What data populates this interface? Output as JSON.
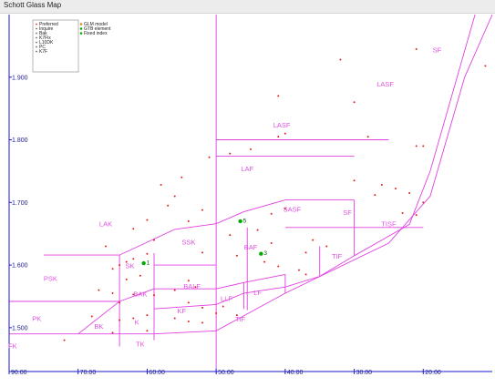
{
  "window": {
    "title": "Schott Glass Map"
  },
  "colors": {
    "axis": "#1a1acc",
    "boundary": "#e040e0",
    "region_label": "#e050e0",
    "glass_point": "#e02020",
    "model_point": "#00aa00",
    "fixed_point": "#00aa00"
  },
  "legend": {
    "left": [
      "Preferred",
      "Inquire",
      "Bak",
      "K7Fix",
      "L10DK",
      "PC",
      "K7F"
    ],
    "right": [
      {
        "label": "GLM model",
        "icon": "diamond-icon",
        "color": "#e08020"
      },
      {
        "label": "GTB element",
        "icon": "circle-icon",
        "color": "#00aa00"
      },
      {
        "label": "Fixed index",
        "icon": "star-icon",
        "color": "#00aa00"
      }
    ]
  },
  "chart_data": {
    "type": "scatter",
    "title": "",
    "xlabel": "",
    "ylabel": "",
    "xlim": [
      90,
      20
    ],
    "ylim": [
      1.43,
      2.0
    ],
    "x_ticks": [
      {
        "v": 90,
        "label": "90.00"
      },
      {
        "v": 80,
        "label": "70.00"
      },
      {
        "v": 70,
        "label": "60.00"
      },
      {
        "v": 60,
        "label": "50.00"
      },
      {
        "v": 50,
        "label": "40.00"
      },
      {
        "v": 40,
        "label": "30.00"
      },
      {
        "v": 30,
        "label": "20.00"
      }
    ],
    "y_ticks": [
      {
        "v": 1.5,
        "label": "1.500"
      },
      {
        "v": 1.6,
        "label": "1.600"
      },
      {
        "v": 1.7,
        "label": "1.700"
      },
      {
        "v": 1.8,
        "label": "1.800"
      },
      {
        "v": 1.9,
        "label": "1.900"
      }
    ],
    "regions": [
      {
        "name": "SF",
        "x": 28,
        "y": 1.94
      },
      {
        "name": "LASF",
        "x": 35.5,
        "y": 1.885
      },
      {
        "name": "LASF",
        "x": 50.5,
        "y": 1.82
      },
      {
        "name": "LAF",
        "x": 55.5,
        "y": 1.75
      },
      {
        "name": "SASF",
        "x": 49,
        "y": 1.685
      },
      {
        "name": "SF",
        "x": 41,
        "y": 1.68
      },
      {
        "name": "TISF",
        "x": 35,
        "y": 1.662
      },
      {
        "name": "LAK",
        "x": 76,
        "y": 1.662
      },
      {
        "name": "SSK",
        "x": 64,
        "y": 1.633
      },
      {
        "name": "BAF",
        "x": 55,
        "y": 1.625
      },
      {
        "name": "TIF",
        "x": 42.5,
        "y": 1.61
      },
      {
        "name": "SK",
        "x": 72.5,
        "y": 1.595
      },
      {
        "name": "PSK",
        "x": 84,
        "y": 1.575
      },
      {
        "name": "BALF",
        "x": 63.5,
        "y": 1.562
      },
      {
        "name": "BAK",
        "x": 71,
        "y": 1.55
      },
      {
        "name": "LF",
        "x": 54,
        "y": 1.552
      },
      {
        "name": "LLF",
        "x": 58.5,
        "y": 1.543
      },
      {
        "name": "KF",
        "x": 65,
        "y": 1.523
      },
      {
        "name": "PK",
        "x": 86,
        "y": 1.511
      },
      {
        "name": "TIF",
        "x": 56.5,
        "y": 1.51
      },
      {
        "name": "K",
        "x": 71.5,
        "y": 1.505
      },
      {
        "name": "BK",
        "x": 77,
        "y": 1.498
      },
      {
        "name": "FK",
        "x": 89.5,
        "y": 1.467
      },
      {
        "name": "TK",
        "x": 71,
        "y": 1.47
      }
    ],
    "boundaries": [
      [
        [
          60,
          2.0
        ],
        [
          60,
          1.43
        ]
      ],
      [
        [
          60,
          1.8
        ],
        [
          35,
          1.8
        ]
      ],
      [
        [
          60,
          1.774
        ],
        [
          40,
          1.774
        ]
      ],
      [
        [
          50,
          1.704
        ],
        [
          40,
          1.704
        ]
      ],
      [
        [
          85,
          1.616
        ],
        [
          74,
          1.616
        ],
        [
          66,
          1.657
        ],
        [
          60,
          1.666
        ],
        [
          56,
          1.685
        ],
        [
          50,
          1.704
        ]
      ],
      [
        [
          74,
          1.616
        ],
        [
          74,
          1.47
        ]
      ],
      [
        [
          69,
          1.619
        ],
        [
          69,
          1.48
        ]
      ],
      [
        [
          60,
          1.6
        ],
        [
          69,
          1.6
        ]
      ],
      [
        [
          55.5,
          1.66
        ],
        [
          55.5,
          1.528
        ]
      ],
      [
        [
          90,
          1.542
        ],
        [
          74,
          1.542
        ]
      ],
      [
        [
          90,
          1.49
        ],
        [
          80,
          1.49
        ],
        [
          74,
          1.542
        ],
        [
          69,
          1.562
        ],
        [
          60,
          1.562
        ],
        [
          56,
          1.572
        ],
        [
          50,
          1.585
        ]
      ],
      [
        [
          74,
          1.49
        ],
        [
          69,
          1.49
        ]
      ],
      [
        [
          80,
          1.49
        ],
        [
          74,
          1.49
        ]
      ],
      [
        [
          69,
          1.49
        ],
        [
          60,
          1.495
        ],
        [
          50,
          1.555
        ],
        [
          35,
          1.635
        ],
        [
          29,
          1.71
        ],
        [
          24,
          1.9
        ],
        [
          20,
          2.0
        ]
      ],
      [
        [
          69,
          1.53
        ],
        [
          60,
          1.537
        ],
        [
          56,
          1.555
        ],
        [
          50,
          1.565
        ],
        [
          45,
          1.582
        ],
        [
          40,
          1.615
        ],
        [
          36,
          1.64
        ],
        [
          32,
          1.665
        ],
        [
          29,
          1.75
        ],
        [
          22.5,
          2.0
        ]
      ],
      [
        [
          56,
          1.572
        ],
        [
          56,
          1.53
        ]
      ],
      [
        [
          50,
          1.585
        ],
        [
          50,
          1.555
        ]
      ],
      [
        [
          45,
          1.582
        ],
        [
          45,
          1.63
        ]
      ],
      [
        [
          40,
          1.615
        ],
        [
          40,
          1.704
        ]
      ],
      [
        [
          40,
          1.66
        ],
        [
          30,
          1.66
        ]
      ],
      [
        [
          50,
          1.66
        ],
        [
          40,
          1.66
        ]
      ]
    ],
    "glasses": [
      [
        42,
        1.928
      ],
      [
        31,
        1.945
      ],
      [
        21,
        1.918
      ],
      [
        51,
        1.87
      ],
      [
        40,
        1.86
      ],
      [
        50,
        1.81
      ],
      [
        51,
        1.805
      ],
      [
        38,
        1.805
      ],
      [
        31,
        1.79
      ],
      [
        30,
        1.79
      ],
      [
        55,
        1.785
      ],
      [
        58,
        1.778
      ],
      [
        61,
        1.772
      ],
      [
        65,
        1.74
      ],
      [
        68,
        1.728
      ],
      [
        40,
        1.735
      ],
      [
        66,
        1.71
      ],
      [
        67,
        1.695
      ],
      [
        62,
        1.688
      ],
      [
        50,
        1.69
      ],
      [
        52,
        1.682
      ],
      [
        31,
        1.68
      ],
      [
        30,
        1.7
      ],
      [
        32,
        1.715
      ],
      [
        34,
        1.722
      ],
      [
        36,
        1.728
      ],
      [
        37,
        1.712
      ],
      [
        33,
        1.683
      ],
      [
        64,
        1.67
      ],
      [
        70,
        1.672
      ],
      [
        72,
        1.658
      ],
      [
        69,
        1.64
      ],
      [
        76,
        1.63
      ],
      [
        58,
        1.648
      ],
      [
        54,
        1.656
      ],
      [
        52,
        1.635
      ],
      [
        62,
        1.62
      ],
      [
        46,
        1.64
      ],
      [
        47,
        1.62
      ],
      [
        44,
        1.63
      ],
      [
        70,
        1.618
      ],
      [
        72,
        1.61
      ],
      [
        73,
        1.605
      ],
      [
        74,
        1.6
      ],
      [
        75,
        1.594
      ],
      [
        57,
        1.615
      ],
      [
        53,
        1.605
      ],
      [
        51,
        1.598
      ],
      [
        48,
        1.592
      ],
      [
        47,
        1.585
      ],
      [
        71,
        1.583
      ],
      [
        73,
        1.577
      ],
      [
        77,
        1.56
      ],
      [
        75,
        1.555
      ],
      [
        72,
        1.553
      ],
      [
        74,
        1.54
      ],
      [
        64,
        1.575
      ],
      [
        63,
        1.565
      ],
      [
        66,
        1.56
      ],
      [
        69,
        1.552
      ],
      [
        64,
        1.54
      ],
      [
        62,
        1.532
      ],
      [
        59,
        1.534
      ],
      [
        60,
        1.523
      ],
      [
        57,
        1.52
      ],
      [
        78,
        1.518
      ],
      [
        74,
        1.512
      ],
      [
        72,
        1.515
      ],
      [
        70,
        1.52
      ],
      [
        66,
        1.515
      ],
      [
        64,
        1.51
      ],
      [
        62,
        1.508
      ],
      [
        82,
        1.48
      ],
      [
        75,
        1.492
      ],
      [
        70,
        1.495
      ]
    ],
    "fixed_points": [
      {
        "label": "1",
        "x": 70.5,
        "y": 1.603
      },
      {
        "label": "5",
        "x": 56.5,
        "y": 1.67
      },
      {
        "label": "3",
        "x": 53.5,
        "y": 1.618
      }
    ]
  }
}
